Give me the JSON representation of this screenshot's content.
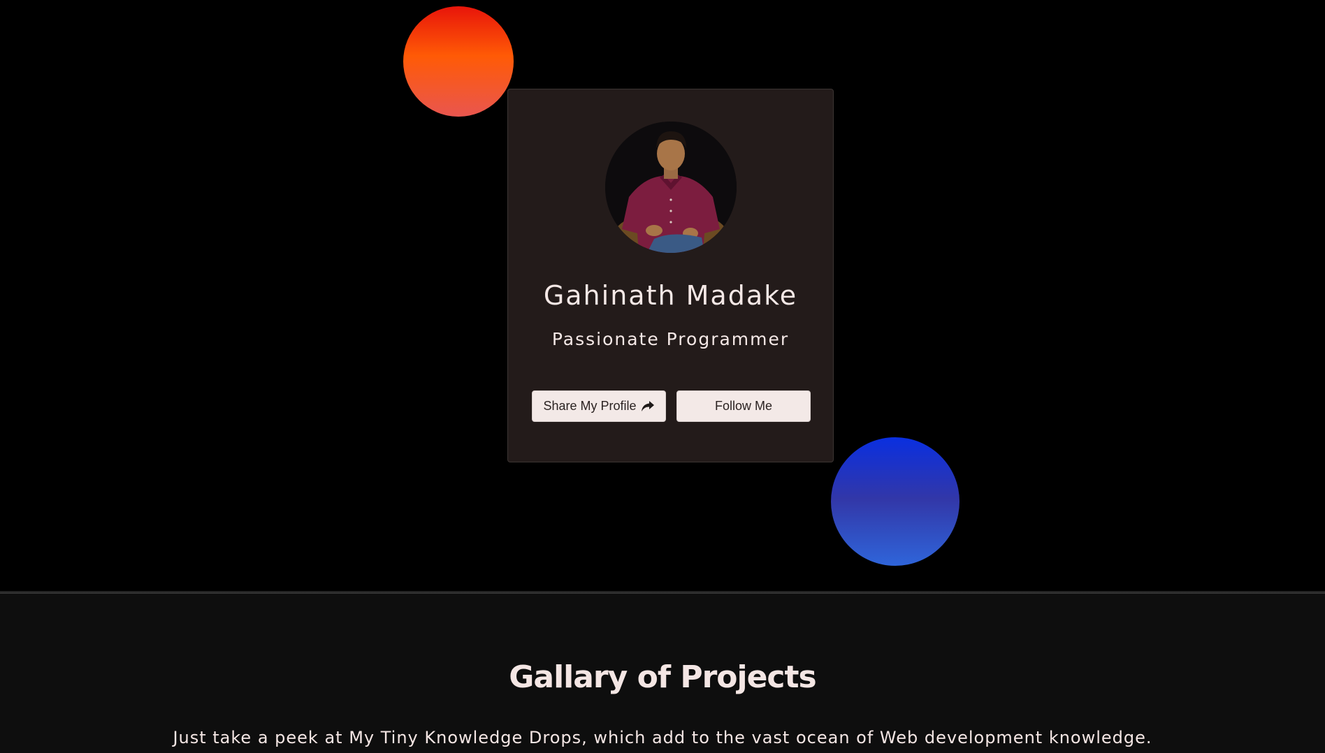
{
  "profile": {
    "name": "Gahinath Madake",
    "role": "Passionate Programmer",
    "share_label": "Share My Profile",
    "follow_label": "Follow Me"
  },
  "gallery": {
    "title": "Gallary of Projects",
    "subtitle": "Just take a peek at My Tiny Knowledge Drops, which add to the vast ocean of Web development knowledge."
  },
  "icons": {
    "share": "share-arrow-icon",
    "avatar": "profile-photo"
  },
  "colors": {
    "background": "#000000",
    "card": "#231b1a",
    "button": "#f3e9e7",
    "text": "#f4e8e6",
    "orb_orange": "#ff5a06",
    "orb_blue": "#2437c8",
    "gallery_bg": "#0e0e0e"
  }
}
